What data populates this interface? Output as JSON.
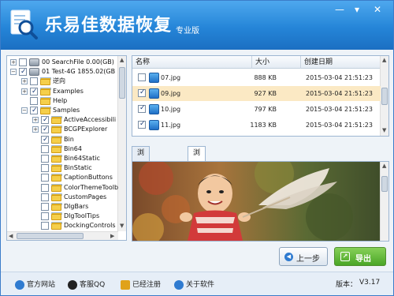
{
  "app": {
    "title": "乐易佳数据恢复",
    "edition": "专业版"
  },
  "window_controls": {
    "minimize_glyph": "—",
    "skin_glyph": "▾",
    "close_glyph": "✕"
  },
  "tree": {
    "items": [
      {
        "label": "00  SearchFile  0.00(GB)",
        "checked": false,
        "kind": "disk",
        "expander": "+"
      },
      {
        "label": "01  Test-4G  1855.02(GB",
        "checked": true,
        "kind": "disk",
        "expander": "−"
      },
      {
        "label": "逆向",
        "checked": false,
        "kind": "folder",
        "expander": "+"
      },
      {
        "label": "Examples",
        "checked": true,
        "kind": "folder",
        "expander": "+"
      },
      {
        "label": "Help",
        "checked": false,
        "kind": "folder",
        "expander": ""
      },
      {
        "label": "Samples",
        "checked": true,
        "kind": "folder",
        "expander": "−"
      },
      {
        "label": "ActiveAccessibili",
        "checked": true,
        "kind": "folder",
        "expander": "+"
      },
      {
        "label": "BCGPExplorer",
        "checked": true,
        "kind": "folder",
        "expander": "+"
      },
      {
        "label": "Bin",
        "checked": true,
        "kind": "folder",
        "expander": ""
      },
      {
        "label": "Bin64",
        "checked": false,
        "kind": "folder",
        "expander": ""
      },
      {
        "label": "Bin64Static",
        "checked": false,
        "kind": "folder",
        "expander": ""
      },
      {
        "label": "BinStatic",
        "checked": false,
        "kind": "folder",
        "expander": ""
      },
      {
        "label": "CaptionButtons",
        "checked": false,
        "kind": "folder",
        "expander": ""
      },
      {
        "label": "ColorThemeToolb",
        "checked": false,
        "kind": "folder",
        "expander": ""
      },
      {
        "label": "CustomPages",
        "checked": false,
        "kind": "folder",
        "expander": ""
      },
      {
        "label": "DlgBars",
        "checked": false,
        "kind": "folder",
        "expander": ""
      },
      {
        "label": "DlgToolTips",
        "checked": false,
        "kind": "folder",
        "expander": ""
      },
      {
        "label": "DockingControls",
        "checked": false,
        "kind": "folder",
        "expander": ""
      }
    ]
  },
  "filelist": {
    "columns": {
      "name": "名称",
      "size": "大小",
      "date": "创建日期"
    },
    "rows": [
      {
        "name": "07.jpg",
        "size": "888 KB",
        "date": "2015-03-04  21:51:23",
        "checked": false,
        "selected": false
      },
      {
        "name": "09.jpg",
        "size": "927 KB",
        "date": "2015-03-04  21:51:23",
        "checked": true,
        "selected": true
      },
      {
        "name": "10.jpg",
        "size": "797 KB",
        "date": "2015-03-04  21:51:23",
        "checked": true,
        "selected": false
      },
      {
        "name": "11.jpg",
        "size": "1183 KB",
        "date": "2015-03-04  21:51:23",
        "checked": true,
        "selected": false
      }
    ]
  },
  "preview_tabs": [
    {
      "label": "浏览十六进制",
      "active": false
    },
    {
      "label": "浏览图像",
      "active": true
    }
  ],
  "buttons": {
    "prev": "上一步",
    "export": "导出"
  },
  "statusbar": {
    "links": [
      {
        "label": "官方网站",
        "icon": "globe-icon",
        "color": "#2f7bd0"
      },
      {
        "label": "客服QQ",
        "icon": "qq-penguin-icon",
        "color": "#222222"
      },
      {
        "label": "已经注册",
        "icon": "key-icon",
        "color": "#e0a21a"
      },
      {
        "label": "关于软件",
        "icon": "info-icon",
        "color": "#2f7bd0"
      }
    ],
    "version_label": "版本：",
    "version_value": "V3.17"
  },
  "colors": {
    "titlebar": "#2585d8",
    "selected_row": "#fbe9c4",
    "export_button": "#4aa626"
  }
}
